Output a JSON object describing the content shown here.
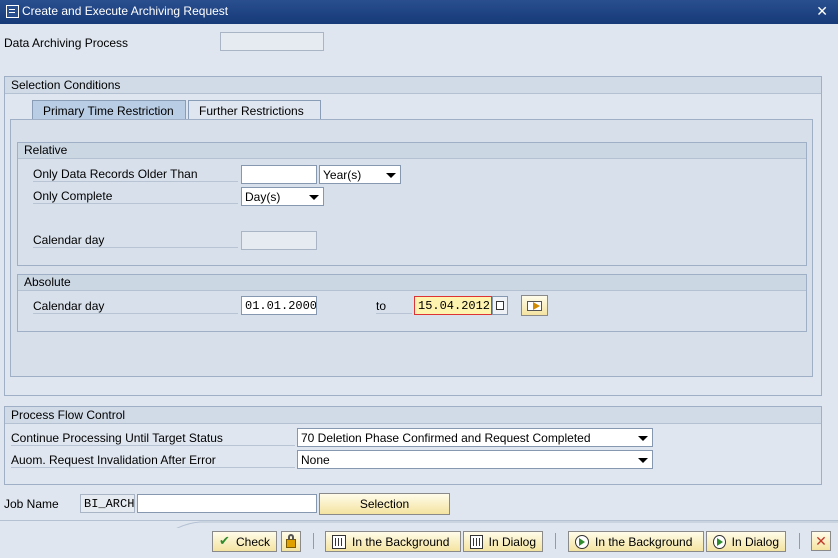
{
  "window": {
    "title": "Create and Execute Archiving Request",
    "close": "✕"
  },
  "process": {
    "label": "Data Archiving Process",
    "value": ""
  },
  "selection": {
    "title": "Selection Conditions",
    "tabs": [
      {
        "label": "Primary Time Restriction",
        "active": true
      },
      {
        "label": "Further Restrictions",
        "active": false
      }
    ],
    "relative": {
      "title": "Relative",
      "older_label": "Only Data Records Older Than",
      "older_value": "",
      "older_unit": "Year(s)",
      "complete_label": "Only Complete",
      "complete_unit": "Day(s)",
      "calday_label": "Calendar day",
      "calday_value": ""
    },
    "absolute": {
      "title": "Absolute",
      "calday_label": "Calendar day",
      "from": "01.01.2000",
      "to_label": "to",
      "to": "15.04.2012"
    }
  },
  "flow": {
    "title": "Process Flow Control",
    "target_label": "Continue Processing Until Target Status",
    "target_value": "70 Deletion Phase Confirmed and Request Completed",
    "invalid_label": "Auom. Request Invalidation After Error",
    "invalid_value": "None"
  },
  "job": {
    "label": "Job Name",
    "prefix": "BI_ARCH",
    "value": "",
    "selection_button": "Selection"
  },
  "toolbar": {
    "check": "Check",
    "bg1": "In the Background",
    "dlg1": "In Dialog",
    "bg2": "In the Background",
    "dlg2": "In Dialog",
    "close": "✕"
  },
  "colors": {
    "titlebar": "#1e4585",
    "button": "#f4e3a0",
    "highlight_field": "#fff3b0"
  }
}
